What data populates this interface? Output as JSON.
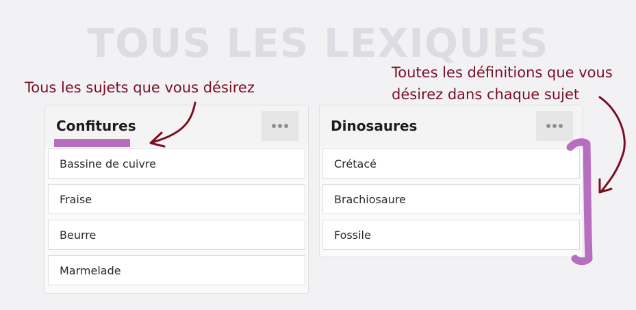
{
  "page_title": "TOUS LES LEXIQUES",
  "annotations": {
    "left": "Tous les sujets que vous désirez",
    "right_line1": "Toutes les définitions que vous",
    "right_line2": "désirez dans chaque sujet"
  },
  "boards": [
    {
      "title": "Confitures",
      "cards": [
        "Bassine de cuivre",
        "Fraise",
        "Beurre",
        "Marmelade"
      ]
    },
    {
      "title": "Dinosaures",
      "cards": [
        "Crétacé",
        "Brachiosaure",
        "Fossile"
      ]
    }
  ],
  "colors": {
    "annotation": "#7a0d22",
    "highlight": "#b86ebf",
    "page_title": "#dcdde2"
  },
  "icons": {
    "board_menu": "ellipsis-icon"
  }
}
